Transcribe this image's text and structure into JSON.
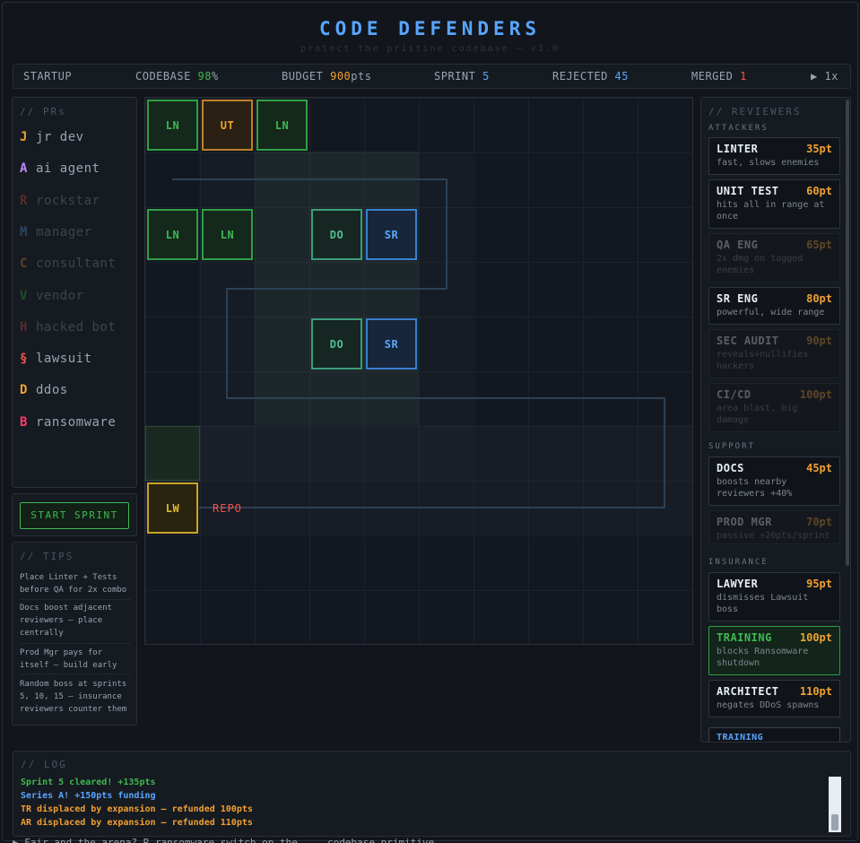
{
  "header": {
    "title": "CODE DEFENDERS",
    "subtitle": "protect the pristine codebase — v3.0"
  },
  "statbar": {
    "phase": "STARTUP",
    "codebase_label": "CODEBASE",
    "codebase_value": "98",
    "codebase_unit": "%",
    "budget_label": "BUDGET",
    "budget_value": "900",
    "budget_unit": "pts",
    "sprint_label": "SPRINT",
    "sprint_value": "5",
    "rejected_label": "REJECTED",
    "rejected_value": "45",
    "merged_label": "MERGED",
    "merged_value": "1",
    "speed": "▶ 1x"
  },
  "prs": {
    "title": "// PRs",
    "items": [
      {
        "letter": "J",
        "name": "jr dev",
        "color": "#f0a030",
        "active": true
      },
      {
        "letter": "A",
        "name": "ai agent",
        "color": "#bc8cff",
        "active": true
      },
      {
        "letter": "R",
        "name": "rockstar",
        "color": "#f85149",
        "active": false
      },
      {
        "letter": "M",
        "name": "manager",
        "color": "#58a6ff",
        "active": false
      },
      {
        "letter": "C",
        "name": "consultant",
        "color": "#f0a030",
        "active": false
      },
      {
        "letter": "V",
        "name": "vendor",
        "color": "#3fb950",
        "active": false
      },
      {
        "letter": "H",
        "name": "hacked bot",
        "color": "#f85149",
        "active": false
      },
      {
        "letter": "§",
        "name": "lawsuit",
        "color": "#f85149",
        "active": true
      },
      {
        "letter": "D",
        "name": "ddos",
        "color": "#f0a030",
        "active": true
      },
      {
        "letter": "B",
        "name": "ransomware",
        "color": "#ff3b6b",
        "active": true
      }
    ]
  },
  "controls": {
    "start_sprint": "START SPRINT"
  },
  "tips": {
    "title": "// TIPS",
    "items": [
      "Place Linter + Tests before QA for 2x combo",
      "Docs boost adjacent reviewers — place centrally",
      "Prod Mgr pays for itself — build early",
      "Random boss at sprints 5, 10, 15 — insurance reviewers counter them"
    ]
  },
  "board": {
    "repo_label": "REPO",
    "towers": [
      {
        "code": "LN",
        "kind": "linter"
      },
      {
        "code": "UT",
        "kind": "unit"
      },
      {
        "code": "LN",
        "kind": "linter"
      },
      {
        "code": "LN",
        "kind": "linter"
      },
      {
        "code": "LN",
        "kind": "linter"
      },
      {
        "code": "DO",
        "kind": "docs"
      },
      {
        "code": "SR",
        "kind": "senior"
      },
      {
        "code": "DO",
        "kind": "docs"
      },
      {
        "code": "SR",
        "kind": "senior"
      },
      {
        "code": "LW",
        "kind": "lawyer"
      }
    ]
  },
  "reviewers": {
    "title": "// REVIEWERS",
    "sections": {
      "attackers": "ATTACKERS",
      "support": "SUPPORT",
      "insurance": "INSURANCE"
    },
    "cards": [
      {
        "name": "LINTER",
        "cost": "35pt",
        "desc": "fast, slows enemies",
        "available": true
      },
      {
        "name": "UNIT TEST",
        "cost": "60pt",
        "desc": "hits all in range at once",
        "available": true
      },
      {
        "name": "QA ENG",
        "cost": "65pt",
        "desc": "2x dmg on tagged enemies",
        "available": false
      },
      {
        "name": "SR ENG",
        "cost": "80pt",
        "desc": "powerful, wide range",
        "available": true
      },
      {
        "name": "SEC AUDIT",
        "cost": "90pt",
        "desc": "reveals+nullifies hackers",
        "available": false
      },
      {
        "name": "CI/CD",
        "cost": "100pt",
        "desc": "area blast, big damage",
        "available": false
      },
      {
        "name": "DOCS",
        "cost": "45pt",
        "desc": "boosts nearby reviewers +40%",
        "available": true
      },
      {
        "name": "PROD MGR",
        "cost": "70pt",
        "desc": "passive +20pts/sprint",
        "available": false
      },
      {
        "name": "LAWYER",
        "cost": "95pt",
        "desc": "dismisses Lawsuit boss",
        "available": true
      },
      {
        "name": "TRAINING",
        "cost": "100pt",
        "desc": "blocks Ransomware shutdown",
        "available": true,
        "selected": true
      },
      {
        "name": "ARCHITECT",
        "cost": "110pt",
        "desc": "negates DDoS spawns",
        "available": true
      }
    ],
    "partial_card": "TRAINING"
  },
  "log": {
    "title": "// LOG",
    "lines": [
      {
        "text": "Sprint 5 cleared! +135pts",
        "color": "#3fb950"
      },
      {
        "text": "Series A! +150pts funding",
        "color": "#58a6ff"
      },
      {
        "text": "TR displaced by expansion — refunded 100pts",
        "color": "#f0a030"
      },
      {
        "text": "AR displaced by expansion — refunded 110pts",
        "color": "#f0a030"
      }
    ]
  },
  "bottom_partial_text": "▶ Fair and the arena? R          ransomware            switch on the ... codebase primitive",
  "colors": {
    "accent": "#58a6ff",
    "green": "#3fb950",
    "orange": "#f0a030",
    "red": "#f85149"
  }
}
